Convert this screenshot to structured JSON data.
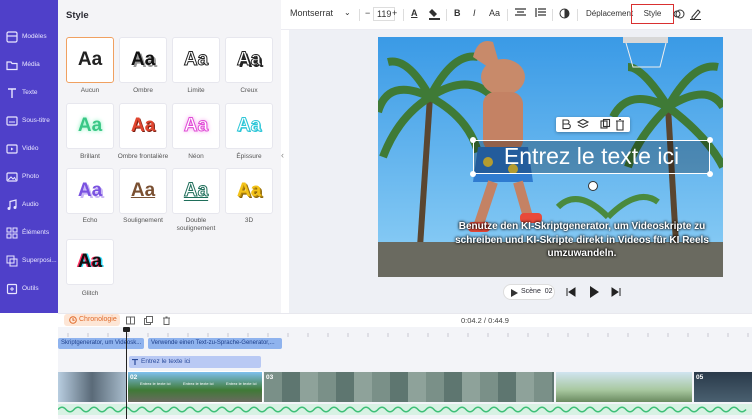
{
  "sidebar": {
    "items": [
      {
        "label": "Modèles",
        "icon": "template-icon"
      },
      {
        "label": "Média",
        "icon": "media-folder-icon"
      },
      {
        "label": "Texte",
        "icon": "text-icon"
      },
      {
        "label": "Sous-titre",
        "icon": "subtitle-icon"
      },
      {
        "label": "Vidéo",
        "icon": "video-icon"
      },
      {
        "label": "Photo",
        "icon": "photo-icon"
      },
      {
        "label": "Audio",
        "icon": "audio-icon"
      },
      {
        "label": "Éléments",
        "icon": "elements-icon"
      },
      {
        "label": "Superposi...",
        "icon": "overlay-icon"
      },
      {
        "label": "Outils",
        "icon": "tools-icon"
      }
    ]
  },
  "style_panel": {
    "title": "Style",
    "sample": "Aa",
    "styles": [
      {
        "label": "Aucun",
        "selected": true
      },
      {
        "label": "Ombre"
      },
      {
        "label": "Limite"
      },
      {
        "label": "Creux"
      },
      {
        "label": "Brillant"
      },
      {
        "label": "Ombre frontalière"
      },
      {
        "label": "Néon"
      },
      {
        "label": "Épissure"
      },
      {
        "label": "Echo"
      },
      {
        "label": "Soulignement"
      },
      {
        "label": "Double soulignement"
      },
      {
        "label": "3D"
      },
      {
        "label": "Glitch"
      }
    ]
  },
  "toolbar": {
    "font": "Montserrat",
    "font_size": "119",
    "minus": "−",
    "plus": "+",
    "font_color_glyph": "A",
    "bold_glyph": "B",
    "italic_glyph": "I",
    "case_glyph": "Aa",
    "move_label": "Déplacement",
    "style_label": "Style"
  },
  "preview": {
    "main_text": "Entrez le texte ici",
    "subtitle": "Benutze den KI-Skriptgenerator, um Videoskripte zu schreiben und KI-Skripte direkt in Videos für KI Reels umzuwandeln.",
    "scene_label": "Scène",
    "scene_number": "02"
  },
  "timeline": {
    "chronologie_label": "Chronologie",
    "time_readout": "0:04.2 / 0:44.9",
    "subtitle_clip_1": "Skriptgenerator, um Videosk...",
    "subtitle_clip_2": "Verwende einen Text-zu-Sprache-Generator,...",
    "text_clip": "Entrez le texte ici",
    "segment_labels": [
      "02",
      "03",
      "05"
    ],
    "segment_caption": "Entrez le texte ici"
  },
  "colors": {
    "sidebar": "#4f40c9",
    "accent": "#e06a2a",
    "style_button_border": "#d93030"
  }
}
